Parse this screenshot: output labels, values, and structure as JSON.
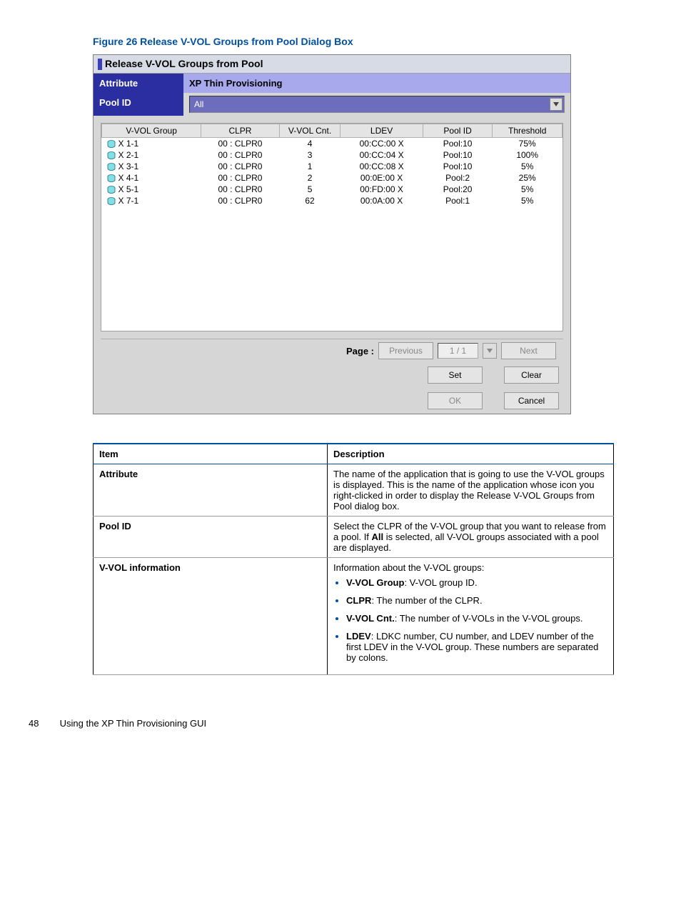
{
  "figure_title": "Figure 26 Release V-VOL Groups from Pool Dialog Box",
  "dialog": {
    "title": "Release V-VOL Groups from Pool",
    "attribute_label": "Attribute",
    "attribute_value": "XP Thin Provisioning",
    "poolid_label": "Pool ID",
    "poolid_value": "All"
  },
  "table": {
    "columns": [
      "V-VOL Group",
      "CLPR",
      "V-VOL Cnt.",
      "LDEV",
      "Pool ID",
      "Threshold"
    ],
    "rows": [
      {
        "group": "X 1-1",
        "clpr": "00 : CLPR0",
        "cnt": "4",
        "ldev": "00:CC:00 X",
        "pool": "Pool:10",
        "thr": "75%"
      },
      {
        "group": "X 2-1",
        "clpr": "00 : CLPR0",
        "cnt": "3",
        "ldev": "00:CC:04 X",
        "pool": "Pool:10",
        "thr": "100%"
      },
      {
        "group": "X 3-1",
        "clpr": "00 : CLPR0",
        "cnt": "1",
        "ldev": "00:CC:08 X",
        "pool": "Pool:10",
        "thr": "5%"
      },
      {
        "group": "X 4-1",
        "clpr": "00 : CLPR0",
        "cnt": "2",
        "ldev": "00:0E:00 X",
        "pool": "Pool:2",
        "thr": "25%"
      },
      {
        "group": "X 5-1",
        "clpr": "00 : CLPR0",
        "cnt": "5",
        "ldev": "00:FD:00 X",
        "pool": "Pool:20",
        "thr": "5%"
      },
      {
        "group": "X 7-1",
        "clpr": "00 : CLPR0",
        "cnt": "62",
        "ldev": "00:0A:00 X",
        "pool": "Pool:1",
        "thr": "5%"
      }
    ]
  },
  "pager": {
    "label": "Page :",
    "previous": "Previous",
    "indicator": "1 / 1",
    "next": "Next"
  },
  "buttons": {
    "set": "Set",
    "clear": "Clear",
    "ok": "OK",
    "cancel": "Cancel"
  },
  "desc": {
    "head_item": "Item",
    "head_desc": "Description",
    "rows": [
      {
        "item": "Attribute",
        "desc": "The name of the application that is going to use the V-VOL groups is displayed. This is the name of the application whose icon you right-clicked in order to display the Release V-VOL Groups from Pool dialog box."
      },
      {
        "item": "Pool ID",
        "desc": "Select the CLPR of the V-VOL group that you want to release from a pool. If <b>All</b> is selected, all V-VOL groups associated with a pool are displayed."
      },
      {
        "item": "V-VOL information",
        "desc_intro": "Information about the V-VOL groups:",
        "bullets": [
          "<b>V-VOL Group</b>: V-VOL group ID.",
          "<b>CLPR</b>: The number of the CLPR.",
          "<b>V-VOL Cnt.</b>: The number of V-VOLs in the V-VOL groups.",
          "<b>LDEV</b>: LDKC number, CU number, and LDEV number of the first LDEV in the V-VOL group. These numbers are separated by colons."
        ]
      }
    ]
  },
  "footer": {
    "page": "48",
    "text": "Using the XP Thin Provisioning GUI"
  }
}
